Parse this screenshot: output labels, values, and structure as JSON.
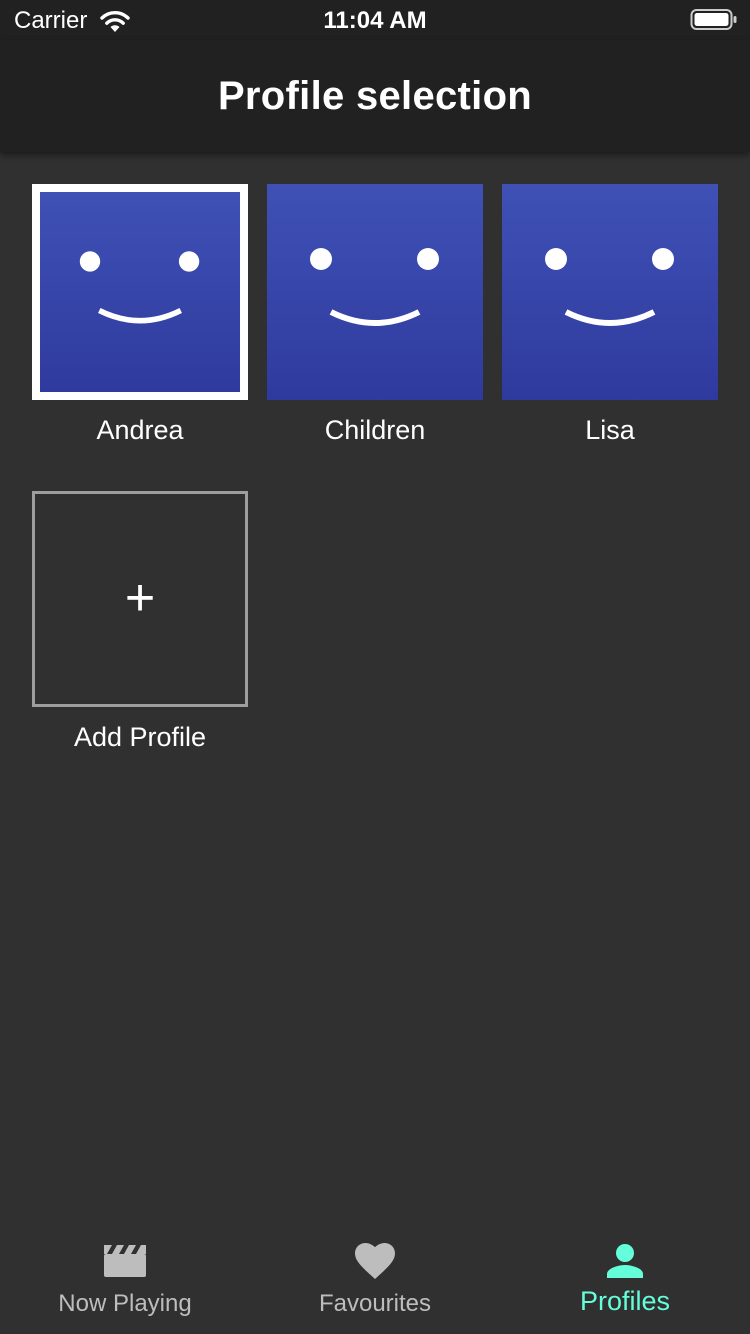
{
  "status_bar": {
    "carrier": "Carrier",
    "time": "11:04 AM",
    "wifi_icon": "wifi-icon",
    "battery_icon": "battery-icon"
  },
  "app_bar": {
    "title": "Profile selection"
  },
  "profiles": [
    {
      "name": "Andrea",
      "selected": true,
      "avatar_icon": "smiley-face-icon"
    },
    {
      "name": "Children",
      "selected": false,
      "avatar_icon": "smiley-face-icon"
    },
    {
      "name": "Lisa",
      "selected": false,
      "avatar_icon": "smiley-face-icon"
    }
  ],
  "add_profile": {
    "label": "Add Profile",
    "icon": "plus-icon",
    "glyph": "+"
  },
  "bottom_nav": {
    "items": [
      {
        "label": "Now Playing",
        "icon": "clapperboard-icon",
        "active": false
      },
      {
        "label": "Favourites",
        "icon": "heart-icon",
        "active": false
      },
      {
        "label": "Profiles",
        "icon": "person-icon",
        "active": true
      }
    ]
  },
  "colors": {
    "background": "#303030",
    "app_bar": "#212121",
    "avatar_top": "#3f51b5",
    "avatar_bottom": "#2f3a9e",
    "accent": "#64ffda",
    "nav_inactive": "#bdbdbd"
  }
}
